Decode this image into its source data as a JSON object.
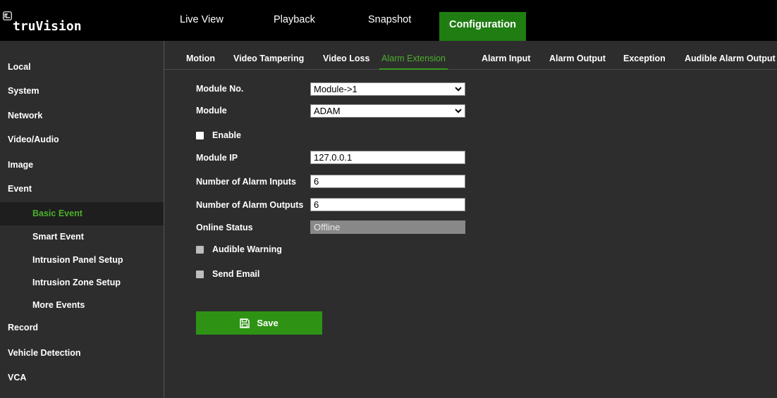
{
  "brand": {
    "name": "truVision"
  },
  "top_nav": {
    "items": [
      "Live View",
      "Playback",
      "Snapshot",
      "Configuration"
    ],
    "active": "Configuration"
  },
  "sidebar": {
    "items": [
      {
        "label": "Local",
        "level": "top"
      },
      {
        "label": "System",
        "level": "top"
      },
      {
        "label": "Network",
        "level": "top"
      },
      {
        "label": "Video/Audio",
        "level": "top"
      },
      {
        "label": "Image",
        "level": "top"
      },
      {
        "label": "Event",
        "level": "top"
      },
      {
        "label": "Basic Event",
        "level": "sub",
        "selected": true
      },
      {
        "label": "Smart Event",
        "level": "sub"
      },
      {
        "label": "Intrusion Panel Setup",
        "level": "sub"
      },
      {
        "label": "Intrusion Zone Setup",
        "level": "sub"
      },
      {
        "label": "More Events",
        "level": "sub"
      },
      {
        "label": "Record",
        "level": "top"
      },
      {
        "label": "Vehicle Detection",
        "level": "top"
      },
      {
        "label": "VCA",
        "level": "top"
      }
    ]
  },
  "tabs": {
    "items": [
      "Motion",
      "Video Tampering",
      "Video Loss",
      "Alarm Extension",
      "Alarm Input",
      "Alarm Output",
      "Exception",
      "Audible Alarm Output"
    ],
    "active": "Alarm Extension"
  },
  "form": {
    "module_no": {
      "label": "Module No.",
      "value": "Module->1"
    },
    "module": {
      "label": "Module",
      "value": "ADAM"
    },
    "enable": {
      "label": "Enable",
      "checked": false
    },
    "module_ip": {
      "label": "Module IP",
      "value": "127.0.0.1"
    },
    "alarm_inputs": {
      "label": "Number of Alarm Inputs",
      "value": "6"
    },
    "alarm_outputs": {
      "label": "Number of Alarm Outputs",
      "value": "6"
    },
    "online_status": {
      "label": "Online Status",
      "value": "Offline"
    },
    "audible_warning": {
      "label": "Audible Warning",
      "checked": false,
      "disabled": true
    },
    "send_email": {
      "label": "Send Email",
      "checked": false,
      "disabled": true
    }
  },
  "save_button": {
    "label": "Save",
    "icon": "floppy-disk-icon"
  },
  "colors": {
    "accent": "#2e9315",
    "active_text": "#4caf2c",
    "background": "#2d2d2d",
    "topbar": "#000000"
  }
}
